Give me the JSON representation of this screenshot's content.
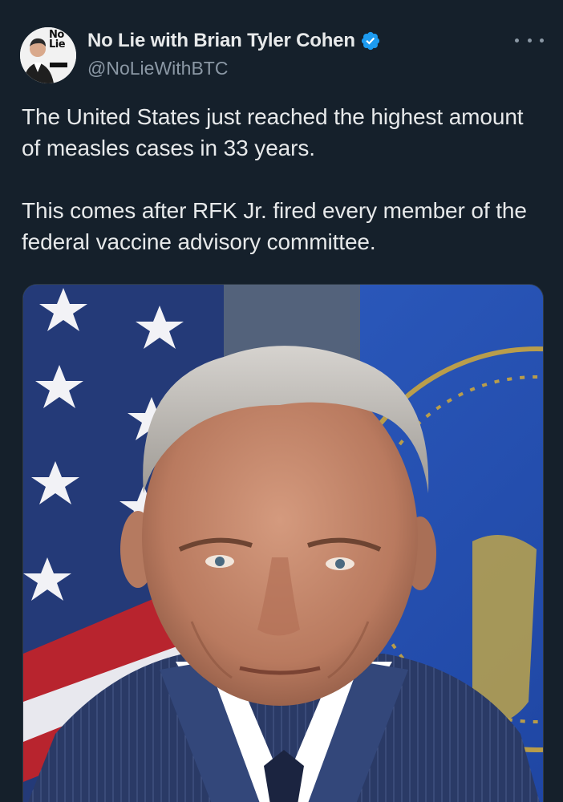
{
  "author": {
    "display_name": "No Lie with Brian Tyler Cohen",
    "handle": "@NoLieWithBTC",
    "avatar_text": "No Lie",
    "verified": true
  },
  "tweet": {
    "paragraphs": [
      "The United States just reached the highest amount of measles cases in 33 years.",
      "This comes after RFK Jr. fired every member of the federal vaccine advisory committee."
    ]
  },
  "media": {
    "kind": "portrait photo"
  },
  "colors": {
    "background": "#15202b",
    "text": "#e7e9ea",
    "secondary_text": "#8b98a5",
    "verified_blue": "#1d9bf0"
  },
  "icons": {
    "verified": "verified-badge-icon",
    "more": "more-options-icon"
  }
}
